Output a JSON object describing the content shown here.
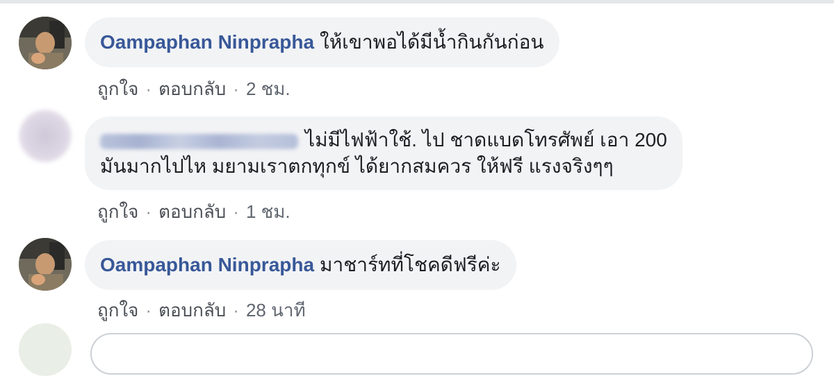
{
  "comments": [
    {
      "author": "Oampaphan Ninprapha",
      "lines": [
        "ให้เขาพอได้มีน้ำกินกันก่อน"
      ],
      "like_label": "ถูกใจ",
      "reply_label": "ตอบกลับ",
      "separator": "·",
      "time": "2 ชม."
    },
    {
      "author": "",
      "lines": [
        "ไม่มีไฟฟ้าใช้. ไป ชาดแบดโทรศัพย์ เอา 200",
        "มันมากไปไห มยามเราตกทุกข์ ได้ยากสมควร ให้ฟรี แรงจริงๆๆ"
      ],
      "like_label": "ถูกใจ",
      "reply_label": "ตอบกลับ",
      "separator": "·",
      "time": "1 ชม."
    },
    {
      "author": "Oampaphan Ninprapha",
      "lines": [
        "มาชาร์ทที่โชคดีฟรีค่ะ"
      ],
      "like_label": "ถูกใจ",
      "reply_label": "ตอบกลับ",
      "separator": "·",
      "time": "28 นาที"
    }
  ],
  "colors": {
    "author": "#385898",
    "bubble": "#f2f3f5",
    "meta": "#606770",
    "text": "#1c1e21"
  }
}
